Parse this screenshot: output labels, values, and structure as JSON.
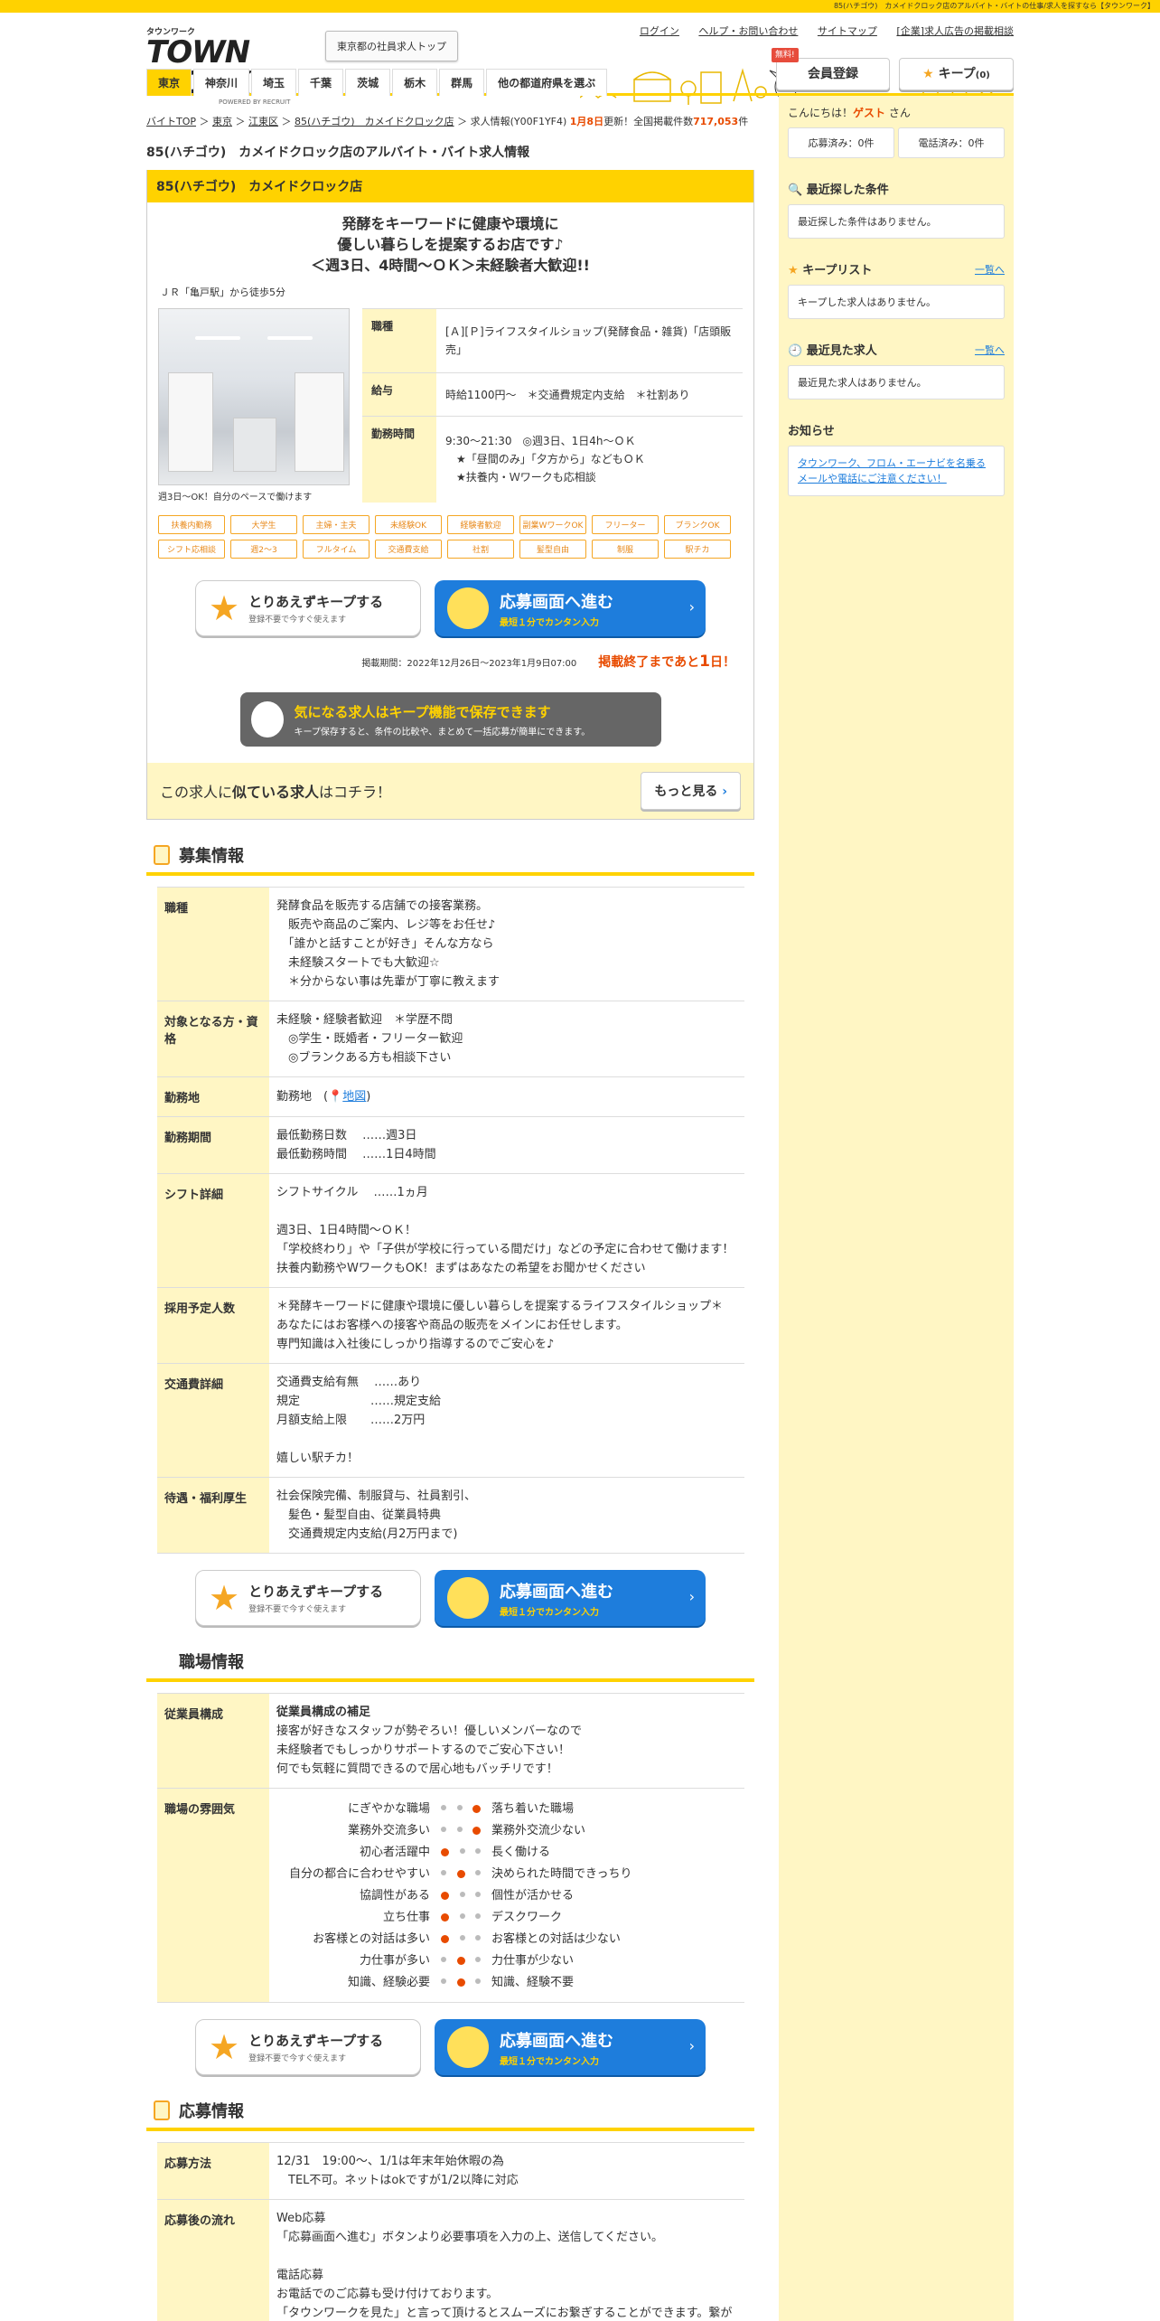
{
  "topbar": "85(ハチゴウ)　カメイドクロック店のアルバイト・バイトの仕事/求人を探すなら【タウンワーク】",
  "logo": {
    "small": "タウンワーク",
    "big": "TOWN WORK",
    "by": "POWERED BY RECRUIT"
  },
  "top_button": "東京都の社員求人トップ",
  "toplinks": [
    "ログイン",
    "ヘルプ・お問い合わせ",
    "サイトマップ",
    "[企業]求人広告の掲載相談"
  ],
  "member": {
    "free": "無料!",
    "label": "会員登録"
  },
  "keep": {
    "label": "キープ",
    "count": "(0)"
  },
  "nav": [
    "東京",
    "神奈川",
    "埼玉",
    "千葉",
    "茨城",
    "栃木",
    "群馬",
    "他の都道府県を選ぶ"
  ],
  "breadcrumbs": [
    "バイトTOP",
    "東京",
    "江東区",
    "85(ハチゴウ)　カメイドクロック店",
    "求人情報(Y00F1YF4)"
  ],
  "update": {
    "date": "1月8日",
    "suffix": "更新！全国掲載件数",
    "count": "717,053",
    "unit": "件"
  },
  "page_title": "85(ハチゴウ)　カメイドクロック店のアルバイト・バイト求人情報",
  "card": {
    "head": "85(ハチゴウ)　カメイドクロック店",
    "catch1": "発酵をキーワードに健康や環境に",
    "catch2": "優しい暮らしを提案するお店です♪",
    "catch3": "＜週3日、4時間～ＯＫ＞未経験者大歓迎!!",
    "access": "ＪＲ「亀戸駅」から徒歩5分",
    "photo_caption": "週3日～OK！自分のペースで働けます",
    "info": [
      {
        "label": "職種",
        "value": "[Ａ][Ｐ]ライフスタイルショップ(発酵食品・雑貨)「店頭販売」"
      },
      {
        "label": "給与",
        "value": "時給1100円～　＊交通費規定内支給　＊社割あり"
      },
      {
        "label": "勤務時間",
        "value": "9:30～21:30　◎週3日、1日4h～ＯＫ\n　★「昼間のみ」「夕方から」などもＯＫ\n　★扶養内・Ｗワークも応相談"
      }
    ],
    "tags": [
      "扶養内勤務",
      "大学生",
      "主婦・主夫",
      "未経験OK",
      "経験者歓迎",
      "副業WワークOK",
      "フリーター",
      "ブランクOK",
      "シフト応相談",
      "週2～3",
      "フルタイム",
      "交通費支給",
      "社割",
      "髪型自由",
      "制服",
      "駅チカ"
    ]
  },
  "buttons": {
    "keep_t1": "とりあえずキープする",
    "keep_t2": "登録不要で今すぐ使えます",
    "apply_t1": "応募画面へ進む",
    "apply_t2": "最短１分でカンタン入力"
  },
  "period": {
    "text": "掲載期間：2022年12月26日～2023年1月9日07:00",
    "end_prefix": "掲載終了まであと",
    "end_num": "1",
    "end_suffix": "日！"
  },
  "keep_promo": {
    "t1": "気になる求人はキープ機能で保存できます",
    "t2": "キープ保存すると、条件の比較や、まとめて一括応募が簡単にできます。"
  },
  "similar": {
    "pre": "この求人に",
    "bold": "似ている求人",
    "post": "はコチラ！",
    "more": "もっと見る"
  },
  "sections": {
    "recruit": "募集情報",
    "workplace": "職場情報",
    "apply": "応募情報"
  },
  "recruit": [
    {
      "label": "職種",
      "value": "発酵食品を販売する店舗での接客業務。\n　販売や商品のご案内、レジ等をお任せ♪\n　「誰かと話すことが好き」そんな方なら\n　未経験スタートでも大歓迎☆\n　＊分からない事は先輩が丁寧に教えます"
    },
    {
      "label": "対象となる方・資格",
      "value": "未経験・経験者歓迎　＊学歴不問\n　◎学生・既婚者・フリーター歓迎\n　◎ブランクある方も相談下さい"
    },
    {
      "label": "勤務期間",
      "value": "最低勤務日数　 ……週3日\n最低勤務時間　 ……1日4時間"
    },
    {
      "label": "シフト詳細",
      "value": "シフトサイクル　 ……1ヵ月\n\n週3日、1日4時間～ＯＫ！\n「学校終わり」や「子供が学校に行っている間だけ」などの予定に合わせて働けます！\n扶養内勤務やWワークもOK！まずはあなたの希望をお聞かせください"
    },
    {
      "label": "採用予定人数",
      "value": "＊発酵キーワードに健康や環境に優しい暮らしを提案するライフスタイルショップ＊\nあなたにはお客様への接客や商品の販売をメインにお任せします。\n専門知識は入社後にしっかり指導するのでご安心を♪"
    },
    {
      "label": "交通費詳細",
      "value": "交通費支給有無　 ……あり\n規定　　　　　　……規定支給\n月額支給上限　　……2万円\n\n嬉しい駅チカ！"
    },
    {
      "label": "待遇・福利厚生",
      "value": "社会保険完備、制服貸与、社員割引、\n　髪色・髪型自由、従業員特典\n　交通費規定内支給(月2万円まで)"
    }
  ],
  "location": {
    "label": "勤務地",
    "prefix": "勤務地　(",
    "map": "地図",
    "suffix": ")"
  },
  "workplace": {
    "staff_label": "従業員構成",
    "staff_title": "従業員構成の補足",
    "staff_text": "接客が好きなスタッフが勢ぞろい！優しいメンバーなので\n未経験者でもしっかりサポートするのでご安心下さい！\n何でも気軽に質問できるので居心地もバッチリです！",
    "atm_label": "職場の雰囲気",
    "atmosphere": [
      {
        "left": "にぎやかな職場",
        "right": "落ち着いた職場",
        "pos": 3
      },
      {
        "left": "業務外交流多い",
        "right": "業務外交流少ない",
        "pos": 3
      },
      {
        "left": "初心者活躍中",
        "right": "長く働ける",
        "pos": 1
      },
      {
        "left": "自分の都合に合わせやすい",
        "right": "決められた時間できっちり",
        "pos": 2
      },
      {
        "left": "協調性がある",
        "right": "個性が活かせる",
        "pos": 1
      },
      {
        "left": "立ち仕事",
        "right": "デスクワーク",
        "pos": 1
      },
      {
        "left": "お客様との対話は多い",
        "right": "お客様との対話は少ない",
        "pos": 1
      },
      {
        "left": "力仕事が多い",
        "right": "力仕事が少ない",
        "pos": 2
      },
      {
        "left": "知識、経験必要",
        "right": "知識、経験不要",
        "pos": 2
      }
    ]
  },
  "apply_info": [
    {
      "label": "応募方法",
      "value": "12/31　19:00～、1/1は年末年始休暇の為\n　TEL不可。ネットはokですが1/2以降に対応"
    },
    {
      "label": "応募後の流れ",
      "value": "Web応募\n「応募画面へ進む」ボタンより必要事項を入力の上、送信してください。\n\n電話応募\nお電話でのご応募も受け付けております。\n「タウンワークを見た」と言って頂けるとスムーズにお繋ぎすることができます。繋がりにくい時は再度おかけ直しください。"
    }
  ],
  "side": {
    "greet_pre": "こんにちは！",
    "guest": "ゲスト",
    "greet_post": "さん",
    "applied": "応募済み：0件",
    "called": "電話済み：0件",
    "recent_cond_title": "最近探した条件",
    "recent_cond_box": "最近探した条件はありません。",
    "keep_title": "キープリスト",
    "keep_link": "一覧へ",
    "keep_box": "キープした求人はありません。",
    "recent_view_title": "最近見た求人",
    "recent_view_link": "一覧へ",
    "recent_view_box": "最近見た求人はありません。",
    "news_title": "お知らせ",
    "news_link": "タウンワーク、フロム・エーナビを名乗るメールや電話にご注意ください！"
  }
}
